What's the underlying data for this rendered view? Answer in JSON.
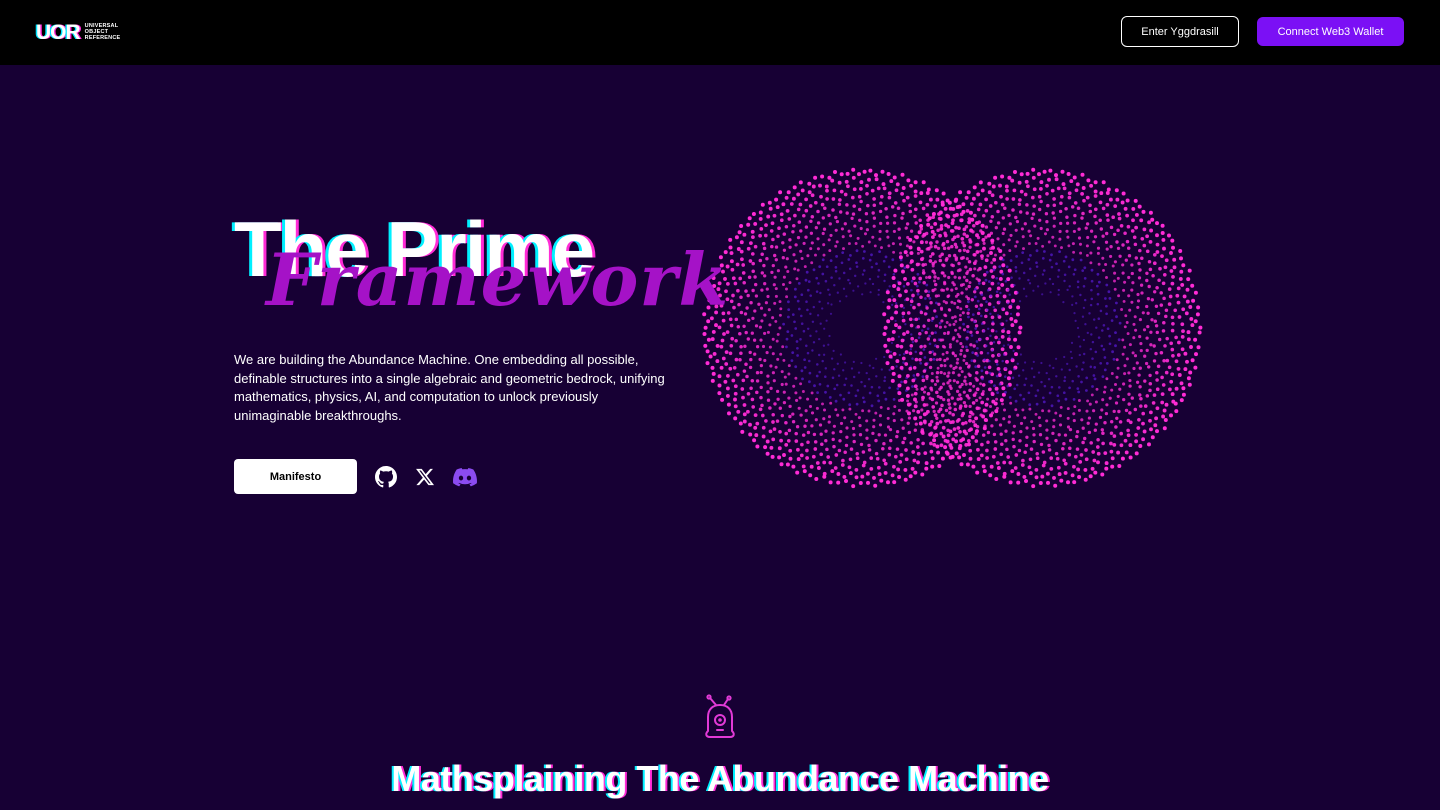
{
  "header": {
    "logo_mark": "UOR",
    "logo_lines": [
      "UNIVERSAL",
      "OBJECT",
      "REFERENCE"
    ],
    "enter_label": "Enter Yggdrasill",
    "wallet_label": "Connect Web3 Wallet"
  },
  "hero": {
    "title_line1": "The Prime",
    "title_line2": "Framework",
    "description": "We are building the Abundance Machine. One embedding all possible, definable structures into a single algebraic and geometric bedrock, unifying mathematics, physics, AI, and computation to unlock previously unimaginable breakthroughs.",
    "manifesto_label": "Manifesto",
    "social_icons": [
      "github-icon",
      "x-icon",
      "discord-icon"
    ]
  },
  "section": {
    "mascot_icon": "alien-mascot-icon",
    "title": "Mathsplaining The Abundance Machine"
  },
  "colors": {
    "background": "#170034",
    "header_bg": "#000000",
    "accent_purple": "#7b10f5",
    "framework_magenta": "#a512c7",
    "dot_magenta": "#ff2bd6",
    "dot_violet": "#5a1bd8",
    "glitch_cyan": "#00f0ff",
    "discord_purple": "#8b4bf0"
  }
}
